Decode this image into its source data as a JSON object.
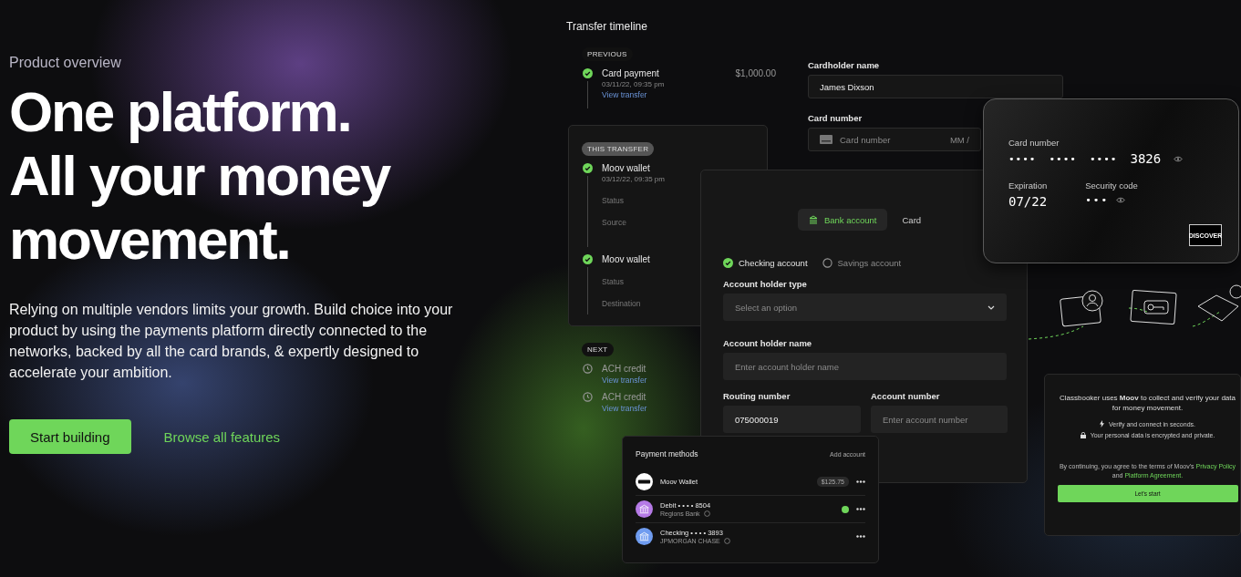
{
  "hero": {
    "eyebrow": "Product overview",
    "headline": [
      "One platform.",
      "All your money",
      "movement."
    ],
    "body": "Relying on multiple vendors limits your growth. Build choice into your product by using the payments platform directly connected to the networks, backed by all the card brands, & expertly designed to accelerate your ambition.",
    "primary_button": "Start building",
    "secondary_link": "Browse all features"
  },
  "timeline": {
    "title": "Transfer timeline",
    "previous": {
      "badge": "PREVIOUS",
      "items": [
        {
          "kind": "done",
          "title": "Card payment",
          "date": "03/11/22, 09:35 pm",
          "link": "View transfer",
          "amount": "$1,000.00"
        }
      ]
    },
    "this_transfer": {
      "badge": "THIS TRANSFER",
      "items": [
        {
          "kind": "done",
          "title": "Moov wallet",
          "date": "03/12/22, 09:35 pm",
          "fields": [
            "Status",
            "Source"
          ]
        },
        {
          "kind": "done",
          "title": "Moov wallet",
          "fields": [
            "Status",
            "Destination"
          ]
        }
      ]
    },
    "next": {
      "badge": "NEXT",
      "items": [
        {
          "kind": "pending",
          "title": "ACH credit",
          "link": "View transfer"
        },
        {
          "kind": "pending",
          "title": "ACH credit",
          "link": "View transfer"
        }
      ]
    }
  },
  "card_form": {
    "fields": [
      {
        "label": "Cardholder name",
        "value": "James Dixson"
      },
      {
        "label": "Card number",
        "placeholder": "Card number",
        "suffix": "MM /"
      }
    ]
  },
  "card_preview": {
    "number_label": "Card number",
    "masked": [
      "••••",
      "••••",
      "••••"
    ],
    "last4": "3826",
    "expiration_label": "Expiration",
    "expiration": "07/22",
    "security_label": "Security code",
    "security": "•••",
    "brand": "DISCOVER"
  },
  "bank_form": {
    "tabs": [
      {
        "label": "Bank account",
        "selected": true
      },
      {
        "label": "Card",
        "selected": false
      }
    ],
    "account_types": [
      {
        "label": "Checking account",
        "selected": true
      },
      {
        "label": "Savings account",
        "selected": false
      }
    ],
    "fields": [
      {
        "label": "Account holder type",
        "kind": "select",
        "placeholder": "Select an option"
      },
      {
        "label": "Account holder name",
        "kind": "text",
        "placeholder": "Enter account holder name"
      }
    ],
    "pair": [
      {
        "label": "Routing number",
        "value": "075000019"
      },
      {
        "label": "Account number",
        "placeholder": "Enter account number"
      }
    ]
  },
  "payment_methods": {
    "title": "Payment methods",
    "action": "Add account",
    "items": [
      {
        "kind": "wallet",
        "name": "Moov Wallet",
        "balance": "$125.75",
        "selected": false
      },
      {
        "kind": "debit",
        "name": "Debit • • • • 8504",
        "sub": "Regions Bank",
        "selected": true
      },
      {
        "kind": "bank",
        "name": "Checking • • • • 3893",
        "sub": "JPMORGAN CHASE",
        "selected": false
      }
    ]
  },
  "consent": {
    "intro": "Classbooker uses **Moov** to collect and verify your data for money movement.",
    "points": [
      {
        "kind": "speed",
        "text": "Verify and connect in seconds."
      },
      {
        "kind": "lock",
        "text": "Your personal data is encrypted and private."
      }
    ],
    "terms": "By continuing, you agree to the terms of Moov's",
    "links": [
      "Privacy Policy",
      "Platform Agreement."
    ],
    "joiner": "and",
    "button": "Let's start"
  }
}
